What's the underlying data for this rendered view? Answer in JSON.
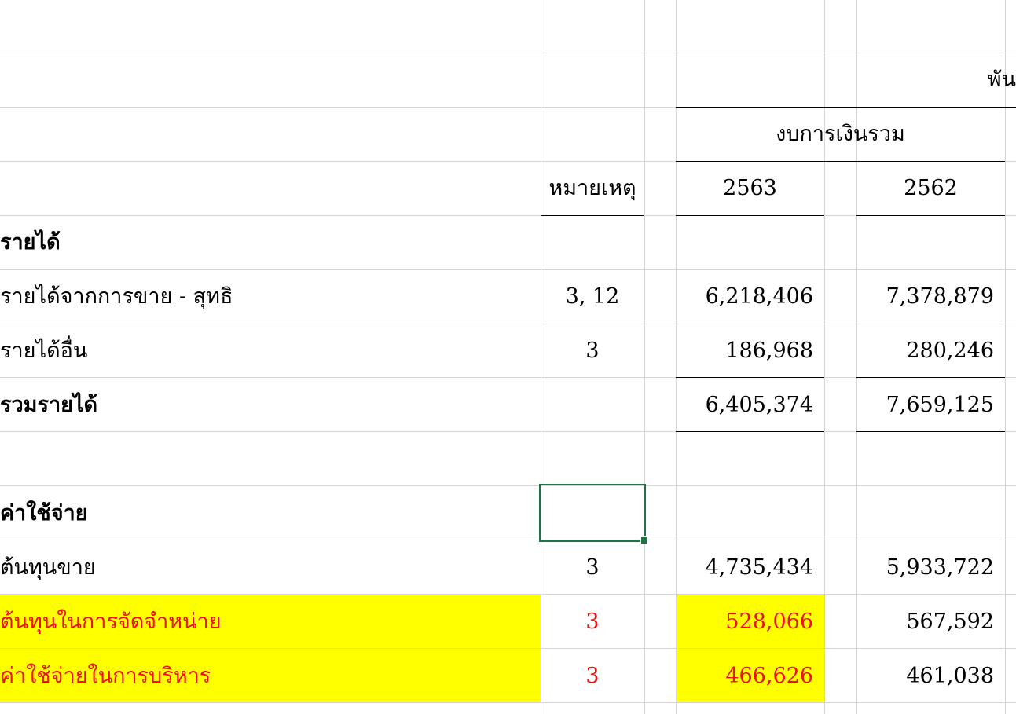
{
  "sheet": {
    "unit_label": "พัน",
    "group_header": "งบการเงินรวม",
    "note_header": "หมายเหตุ",
    "year_current": "2563",
    "year_prior": "2562",
    "highlight_color": "#ffff00",
    "selection_color": "#217346",
    "rows": [
      {
        "label": "รายได้",
        "note": "",
        "current": "",
        "prior": "",
        "bold": true
      },
      {
        "label": "รายได้จากการขาย - สุทธิ",
        "note": "3, 12",
        "current": "6,218,406",
        "prior": "7,378,879",
        "bold": false
      },
      {
        "label": "รายได้อื่น",
        "note": "3",
        "current": "186,968",
        "prior": "280,246",
        "bold": false
      },
      {
        "label": "รวมรายได้",
        "note": "",
        "current": "6,405,374",
        "prior": "7,659,125",
        "bold": true
      },
      {
        "label": "",
        "note": "",
        "current": "",
        "prior": "",
        "bold": false
      },
      {
        "label": "ค่าใช้จ่าย",
        "note": "",
        "current": "",
        "prior": "",
        "bold": true
      },
      {
        "label": "ต้นทุนขาย",
        "note": "3",
        "current": "4,735,434",
        "prior": "5,933,722",
        "bold": false
      },
      {
        "label": "ต้นทุนในการจัดจำหน่าย",
        "note": "3",
        "current": "528,066",
        "prior": "567,592",
        "bold": false,
        "highlight": true
      },
      {
        "label": "ค่าใช้จ่ายในการบริหาร",
        "note": "3",
        "current": "466,626",
        "prior": "461,038",
        "bold": false,
        "highlight": true
      }
    ]
  }
}
